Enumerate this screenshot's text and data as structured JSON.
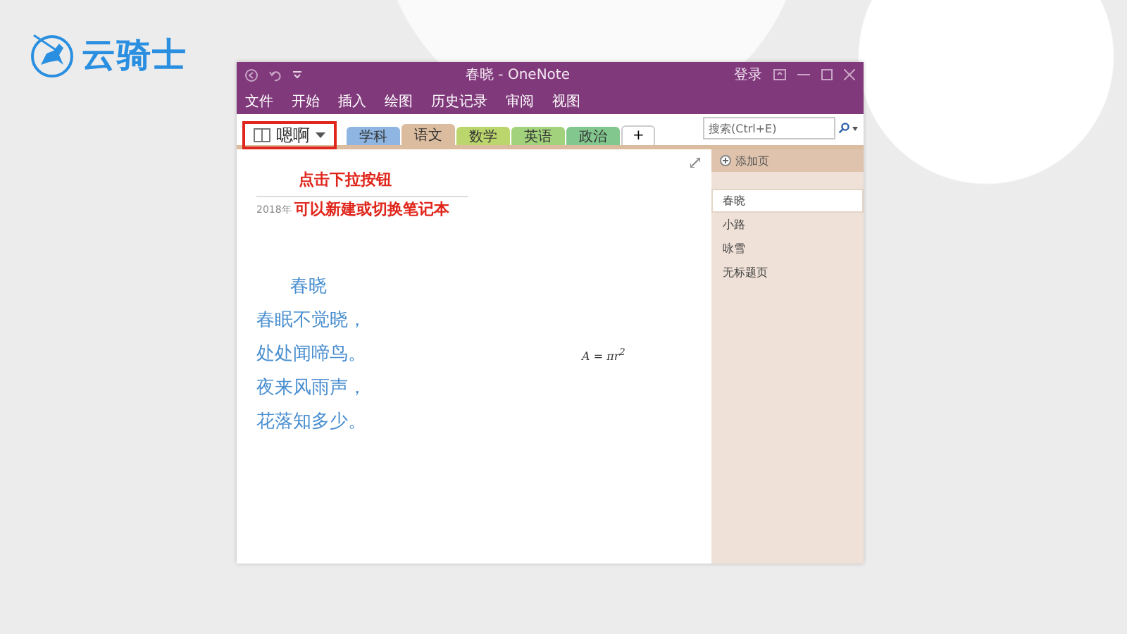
{
  "logo": {
    "text": "云骑士"
  },
  "window": {
    "title": "春晓 - OneNote",
    "sign_in": "登录"
  },
  "menu": [
    "文件",
    "开始",
    "插入",
    "绘图",
    "历史记录",
    "审阅",
    "视图"
  ],
  "notebook": {
    "name": "嗯啊"
  },
  "sections": [
    {
      "label": "学科",
      "color": "#8fb6e2",
      "selected": false
    },
    {
      "label": "语文",
      "color": "#dcbc9e",
      "selected": true
    },
    {
      "label": "数学",
      "color": "#bcd66e",
      "selected": false
    },
    {
      "label": "英语",
      "color": "#a3d27c",
      "selected": false
    },
    {
      "label": "政治",
      "color": "#82c78e",
      "selected": false
    }
  ],
  "add_section": "+",
  "search": {
    "placeholder": "搜索(Ctrl+E)"
  },
  "annotations": [
    "点击下拉按钮",
    "可以新建或切换笔记本"
  ],
  "note": {
    "date": "2018年",
    "poem_title": "春晓",
    "poem_lines": [
      "春眠不觉晓，",
      "处处闻啼鸟。",
      "夜来风雨声，",
      "花落知多少。"
    ],
    "formula": "A = πr$^{2}$"
  },
  "add_page": "添加页",
  "pages": [
    {
      "title": "春晓",
      "selected": true
    },
    {
      "title": "小路",
      "selected": false
    },
    {
      "title": "咏雪",
      "selected": false
    },
    {
      "title": "无标题页",
      "selected": false
    }
  ]
}
